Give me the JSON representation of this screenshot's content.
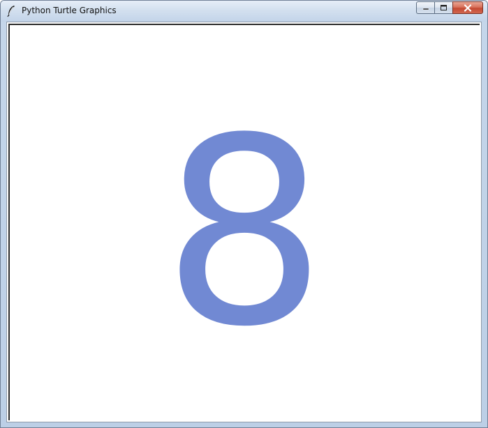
{
  "window": {
    "title": "Python Turtle Graphics",
    "icon": "feather-icon"
  },
  "caption_buttons": {
    "minimize": "minimize-icon",
    "maximize": "maximize-icon",
    "close": "close-icon"
  },
  "canvas": {
    "drawn_text": "8",
    "text_color": "#7189d3",
    "background": "#ffffff"
  }
}
